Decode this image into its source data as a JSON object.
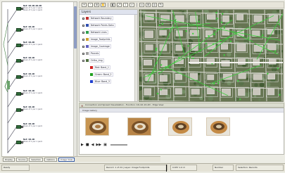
{
  "tree": {
    "nodes": [
      {
        "label": "Net: 1D-1D-1D-2D",
        "sub": "Rows of 1 per 1 pack",
        "sub2": "Rows of 1 per 1 pack"
      },
      {
        "label": "Net: 1D-1D",
        "sub": "Rows of 1 per 1 pack",
        "sub2": ""
      },
      {
        "label": "Net: 1D-2D",
        "sub": "Rows of 1 per 1 pack",
        "sub2": ""
      },
      {
        "label": "Net: 1D-1D",
        "sub": "Rows of 1 per 1 pack",
        "sub2": ""
      },
      {
        "label": "Net: 1D-1D",
        "sub": "Rows of 1 per 1 pack",
        "sub2": ""
      },
      {
        "label": "Net: 1D-1D",
        "sub": "Rows of 1 per 1 pack",
        "sub2": ""
      },
      {
        "label": "Net: 1D-1D",
        "sub": "Rows of 1 per 1 pack",
        "sub2": ""
      },
      {
        "label": "Net: 1D-1D",
        "sub": "Rows of 1 per 1 pack",
        "sub2": ""
      },
      {
        "label": "Net: 1D-1D",
        "sub": "Rows of 1 per 1 pack",
        "sub2": ""
      }
    ]
  },
  "legend": {
    "title": "Layers",
    "rows": [
      {
        "label": "Network Boundary",
        "color": "#c03030"
      },
      {
        "label": "Network Points Data",
        "color": "#3050b0"
      },
      {
        "label": "Network Lines",
        "color": "#30a050"
      },
      {
        "label": "Image_Footprints",
        "color": "#d0a030"
      },
      {
        "label": "Image_Coverage",
        "color": "#6060c0"
      },
      {
        "label": "Parcels",
        "color": "#a0a0a0"
      },
      {
        "label": "Ortho_img",
        "color": "#507040"
      },
      {
        "label": "Red: Band_1",
        "color": "#d02020"
      },
      {
        "label": "Green: Band_2",
        "color": "#20a020"
      },
      {
        "label": "Blue: Band_3",
        "color": "#2040d0"
      }
    ]
  },
  "toolbar": {
    "buttons": [
      "+",
      "-",
      "⊕",
      "✋",
      "◧",
      "⤢",
      "i",
      "⌕",
      "▭",
      "⊞",
      "◎",
      "✎"
    ]
  },
  "lower": {
    "tab_title": "Connection and Spread Visualization - Function: 1D-1D-1D-2D - Edge View",
    "pane_title": "Image Gallery"
  },
  "bottom_tabs": [
    "Display",
    "Source",
    "Selection",
    "Options",
    "Image View"
  ],
  "status": {
    "left": "Ready",
    "middle": "Record: 1 of 24 | Layer: Image Footprints",
    "coords": "0.657 1.0 m",
    "right1": "Number",
    "right2": "Selection: Records"
  }
}
